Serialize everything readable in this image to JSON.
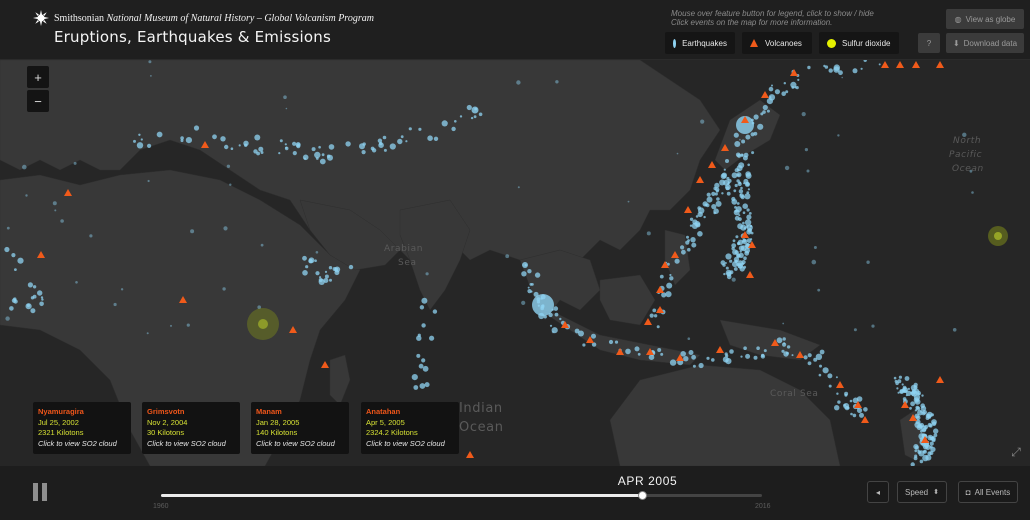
{
  "header": {
    "museum_prefix": "Smithsonian",
    "museum_name": "National Museum of Natural History",
    "program": "– Global Volcanism Program",
    "title": "Eruptions, Earthquakes & Emissions",
    "hint_line1": "Mouse over feature button for legend, click to show / hide",
    "hint_line2": "Click events on the map for more information.",
    "legend": [
      {
        "label": "Earthquakes",
        "color": "#8fd3f2",
        "icon": "circle-icon"
      },
      {
        "label": "Volcanoes",
        "color": "#f05a1a",
        "icon": "triangle-icon"
      },
      {
        "label": "Sulfur dioxide",
        "color": "#e4f000",
        "icon": "circle-icon"
      }
    ],
    "view_globe_label": "View as globe",
    "help_label": "?",
    "download_label": "Download data"
  },
  "map": {
    "zoom_in": "+",
    "zoom_out": "−",
    "labels": {
      "arabian": "Arabian",
      "sea": "Sea",
      "north": "North",
      "pacific": "Pacific",
      "ocean": "Ocean",
      "coral_sea": "Coral Sea",
      "indian": "Indian",
      "indian_ocean": "Ocean"
    },
    "colors": {
      "earthquake": "#8fd3f2",
      "volcano": "#f05a1a",
      "so2": "#9aa61a",
      "land": "#3a3a3a",
      "water": "#262626"
    }
  },
  "eruptions": [
    {
      "name": "Nyamuragira",
      "date": "Jul 25, 2002",
      "amount": "2321 Kilotons",
      "link": "Click to view SO2 cloud"
    },
    {
      "name": "Grimsvotn",
      "date": "Nov 2, 2004",
      "amount": "30 Kilotons",
      "link": "Click to view SO2 cloud"
    },
    {
      "name": "Manam",
      "date": "Jan 28, 2005",
      "amount": "140 Kilotons",
      "link": "Click to view SO2 cloud"
    },
    {
      "name": "Anatahan",
      "date": "Apr 5, 2005",
      "amount": "2324.2 Kilotons",
      "link": "Click to view SO2 cloud"
    }
  ],
  "timeline": {
    "current": "APR  2005",
    "start_year": "1960",
    "end_year": "2016",
    "progress": 0.8,
    "speed_label": "Speed",
    "all_events_label": "All Events",
    "prev_label": "◂"
  }
}
